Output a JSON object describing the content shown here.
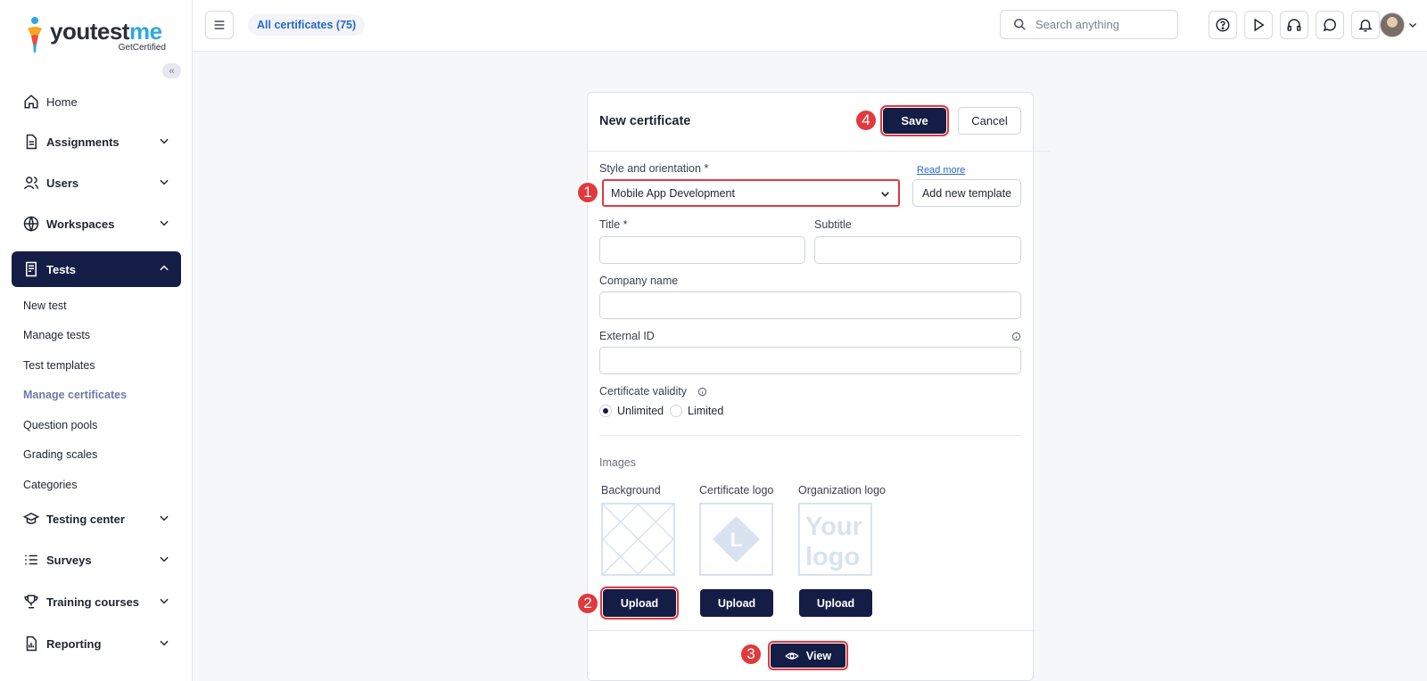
{
  "brand": {
    "name_a": "youtest",
    "name_b": "me",
    "tagline": "GetCertified"
  },
  "sidebar": {
    "items": [
      {
        "label": "Home",
        "icon": "home-icon"
      },
      {
        "label": "Assignments",
        "icon": "document-icon"
      },
      {
        "label": "Users",
        "icon": "users-icon"
      },
      {
        "label": "Workspaces",
        "icon": "globe-icon"
      },
      {
        "label": "Tests",
        "icon": "test-icon"
      },
      {
        "label": "Testing center",
        "icon": "graduation-cap-icon"
      },
      {
        "label": "Surveys",
        "icon": "list-icon"
      },
      {
        "label": "Training courses",
        "icon": "trophy-icon"
      },
      {
        "label": "Reporting",
        "icon": "report-icon"
      }
    ],
    "tests_sub": [
      "New test",
      "Manage tests",
      "Test templates",
      "Manage certificates",
      "Question pools",
      "Grading scales",
      "Categories"
    ]
  },
  "header": {
    "breadcrumb": "All certificates (75)",
    "search_placeholder": "Search anything"
  },
  "form": {
    "title": "New certificate",
    "save": "Save",
    "cancel": "Cancel",
    "style_label": "Style and orientation",
    "required_mark": "*",
    "read_more": "Read more",
    "style_value": "Mobile App Development",
    "add_template": "Add new template",
    "title_label": "Title",
    "subtitle_label": "Subtitle",
    "company_label": "Company name",
    "external_label": "External ID",
    "validity_label": "Certificate validity",
    "validity_options": [
      "Unlimited",
      "Limited"
    ],
    "validity_selected": "Unlimited",
    "images_label": "Images",
    "images": [
      {
        "label": "Background",
        "upload": "Upload"
      },
      {
        "label": "Certificate logo",
        "upload": "Upload"
      },
      {
        "label": "Organization logo",
        "upload": "Upload",
        "placeholder": "Your logo"
      }
    ],
    "logo_letter": "L",
    "view": "View"
  },
  "callouts": [
    "1",
    "2",
    "3",
    "4"
  ],
  "colors": {
    "primary": "#141d45",
    "highlight": "#e0393e",
    "link": "#2768c8"
  }
}
